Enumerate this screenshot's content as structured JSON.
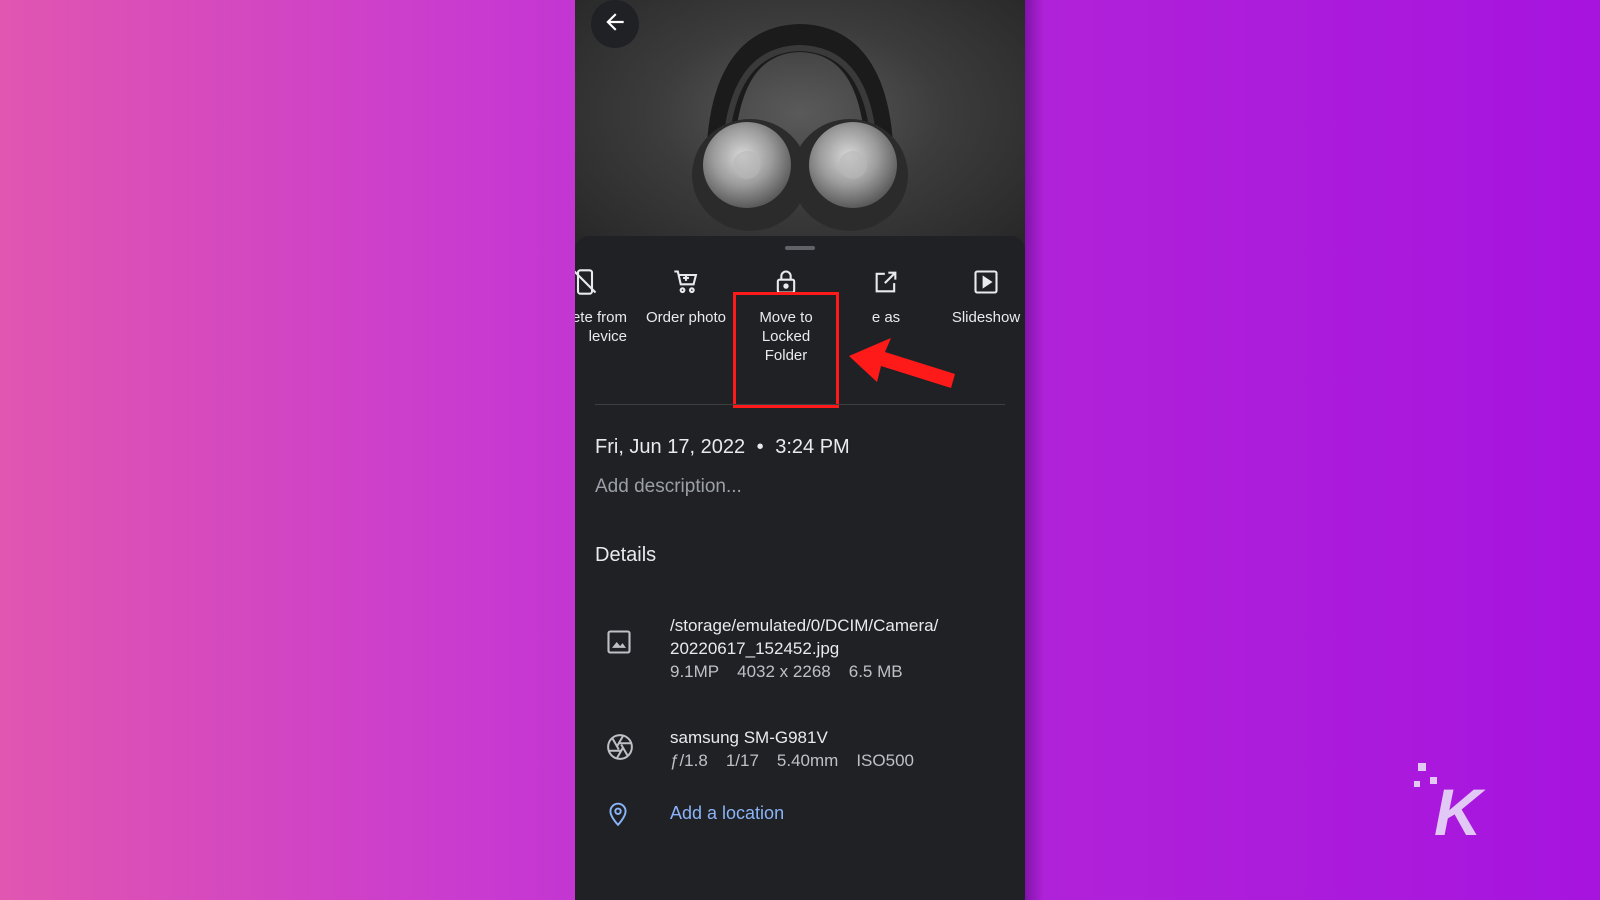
{
  "icons": {
    "back": "arrow-left-icon",
    "delete_device": "phone-off-icon",
    "order": "cart-icon",
    "lock": "lock-icon",
    "use_as": "open-external-icon",
    "slideshow": "play-box-icon",
    "image": "image-icon",
    "camera": "aperture-icon",
    "location": "map-pin-icon"
  },
  "colors": {
    "highlight": "#ff1a1a",
    "link": "#8ab4f8",
    "sheet_bg": "#202124"
  },
  "actions": [
    {
      "label": "ete from\nlevice"
    },
    {
      "label": "Order photo"
    },
    {
      "label": "Move to\nLocked\nFolder"
    },
    {
      "label": "e as"
    },
    {
      "label": "Slideshow"
    }
  ],
  "info": {
    "date": "Fri, Jun 17, 2022",
    "separator": "•",
    "time": "3:24 PM",
    "description_placeholder": "Add description..."
  },
  "details": {
    "title": "Details",
    "file": {
      "path_line1": "/storage/emulated/0/DCIM/Camera/",
      "path_line2": "20220617_152452.jpg",
      "megapixels": "9.1MP",
      "resolution": "4032 x 2268",
      "size": "6.5 MB"
    },
    "camera": {
      "model": "samsung SM-G981V",
      "aperture": "ƒ/1.8",
      "shutter": "1/17",
      "focal": "5.40mm",
      "iso": "ISO500"
    },
    "location_link": "Add a location"
  },
  "watermark": {
    "letter": "K"
  }
}
